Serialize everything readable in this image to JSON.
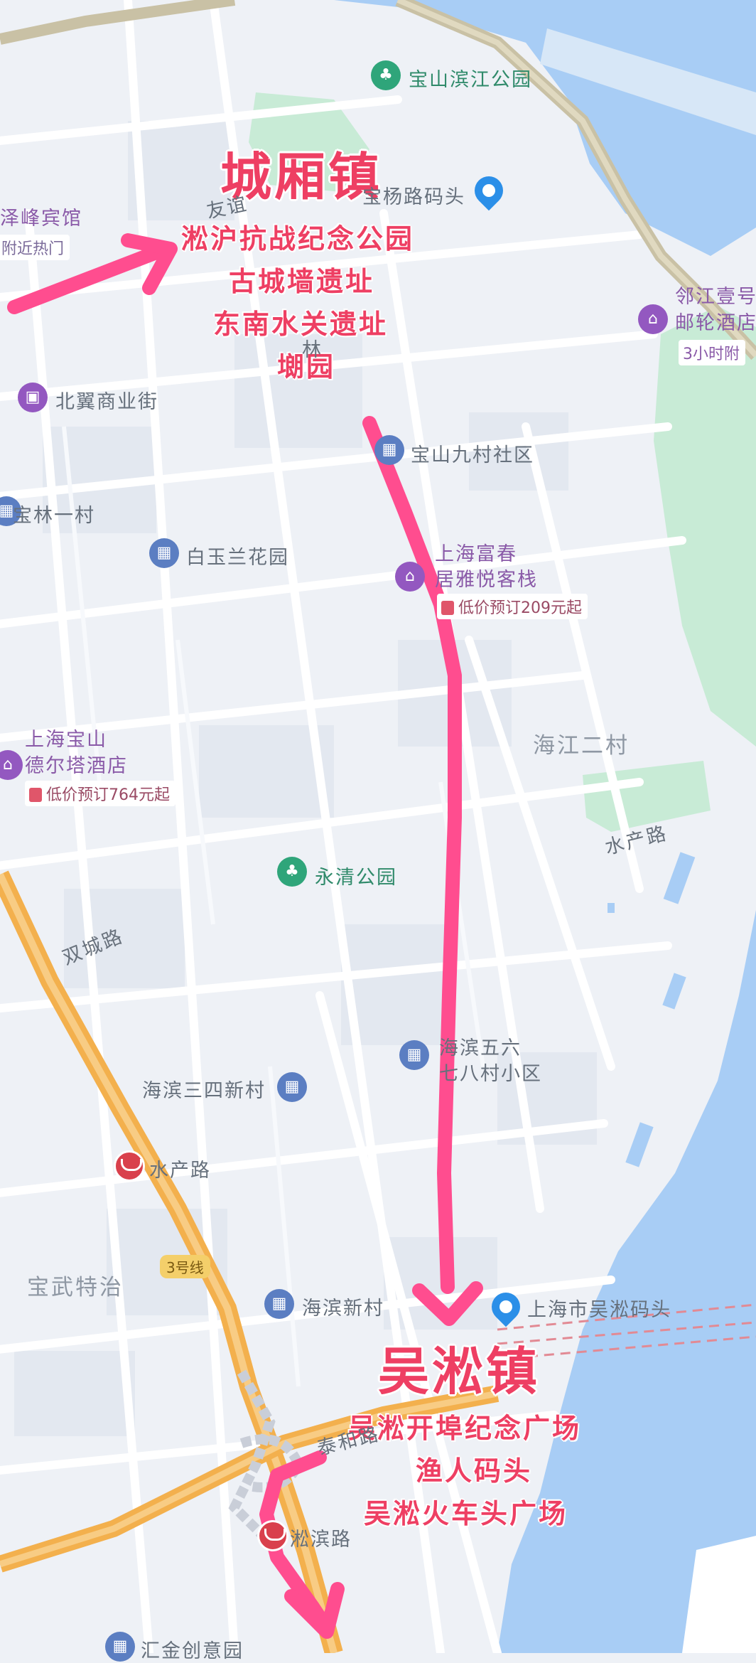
{
  "map": {
    "colors": {
      "land": "#eef1f6",
      "water": "#a8cdf5",
      "park": "#c8ebd6",
      "road": "#ffffff",
      "highway": "#f3b04d",
      "route": "#ff4d8f"
    },
    "towns": {
      "north": {
        "name": "城厢镇",
        "sights": [
          "淞沪抗战纪念公园",
          "古城墙遗址",
          "东南水关遗址",
          "㙟园"
        ]
      },
      "south": {
        "name": "吴淞镇",
        "sights": [
          "吴淞开埠纪念广场",
          "渔人码头",
          "吴淞火车头广场"
        ]
      }
    },
    "pois": {
      "binjiang_park": "宝山滨江公园",
      "ferry_partial": "宝杨路码头",
      "hotel_left_top": "泽峰宾馆",
      "hotel_left_top_note": "附近热门",
      "hotel_right_top_1": "邻江壹号",
      "hotel_right_top_2": "邮轮酒店",
      "hotel_right_top_note": "3小时附",
      "beiyi": "北翼商业街",
      "jiucun": "宝山九村社区",
      "baolin": "宝林一村",
      "baiyulan": "白玉兰花园",
      "fuchun_1": "上海富春",
      "fuchun_2": "居雅悦客栈",
      "fuchun_price": "低价预订209元起",
      "haijiang": "海江二村",
      "delta_1": "上海宝山",
      "delta_2": "德尔塔酒店",
      "delta_price": "低价预订764元起",
      "shuichan_road": "水产路",
      "yongqing": "永清公园",
      "shuangcheng": "双城路",
      "haibin56_1": "海滨五六",
      "haibin56_2": "七八村小区",
      "haibin34": "海滨三四新村",
      "metro_shuichan": "水产路",
      "line3": "3号线",
      "baowu": "宝武特治",
      "haibin_new": "海滨新村",
      "wusong_wharf": "上海市吴淞码头",
      "taihe": "泰和路",
      "songbin": "淞滨路",
      "huijin": "汇金创意园",
      "youyi_partial": "友谊",
      "lin_char": "林"
    },
    "icons": [
      "park-icon",
      "location-pin-icon",
      "hotel-icon",
      "shopping-icon",
      "community-icon",
      "metro-icon"
    ]
  }
}
